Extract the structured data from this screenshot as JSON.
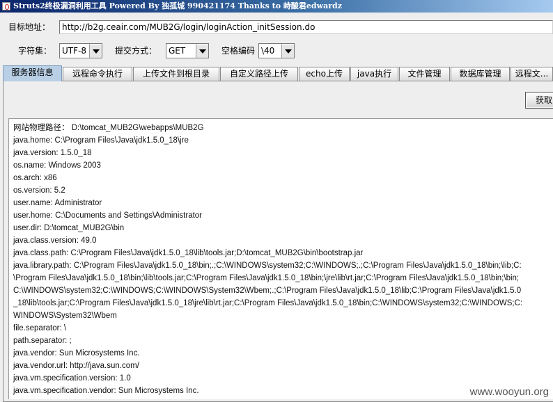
{
  "window": {
    "title": "Struts2终极漏洞利用工具    Powered By 独孤城 990421174 Thanks to 峙酸君edwardz"
  },
  "form": {
    "target_label": "目标地址：",
    "target_url": "http://b2g.ceair.com/MUB2G/login/loginAction_initSession.do",
    "charset_label": "字符集：",
    "charset_value": "UTF-8",
    "method_label": "提交方式：",
    "method_value": "GET",
    "space_encoding_label": "空格编码",
    "space_encoding_value": "\\40"
  },
  "tabs": [
    {
      "label": "服务器信息",
      "active": true
    },
    {
      "label": "远程命令执行"
    },
    {
      "label": "上传文件到根目录"
    },
    {
      "label": "自定义路径上传"
    },
    {
      "label": "echo上传"
    },
    {
      "label": "java执行"
    },
    {
      "label": "文件管理"
    },
    {
      "label": "数据库管理"
    },
    {
      "label": "远程文..."
    }
  ],
  "panel": {
    "fetch_button": "获取"
  },
  "output_lines": [
    "网站物理路径： D:\\tomcat_MUB2G\\webapps\\MUB2G",
    "java.home: C:\\Program Files\\Java\\jdk1.5.0_18\\jre",
    "java.version: 1.5.0_18",
    "os.name: Windows 2003",
    "os.arch: x86",
    "os.version: 5.2",
    "user.name: Administrator",
    "user.home: C:\\Documents and Settings\\Administrator",
    "user.dir: D:\\tomcat_MUB2G\\bin",
    "java.class.version: 49.0",
    "java.class.path: C:\\Program Files\\Java\\jdk1.5.0_18\\lib\\tools.jar;D:\\tomcat_MUB2G\\bin\\bootstrap.jar",
    "java.library.path: C:\\Program Files\\Java\\jdk1.5.0_18\\bin;.;C:\\WINDOWS\\system32;C:\\WINDOWS;.;C:\\Program Files\\Java\\jdk1.5.0_18\\bin;\\lib;C:",
    "\\Program Files\\Java\\jdk1.5.0_18\\bin;\\lib\\tools.jar;C:\\Program Files\\Java\\jdk1.5.0_18\\bin;\\jre\\lib\\rt.jar;C:\\Program Files\\Java\\jdk1.5.0_18\\bin;\\bin;",
    "C:\\WINDOWS\\system32;C:\\WINDOWS;C:\\WINDOWS\\System32\\Wbem;.;C:\\Program Files\\Java\\jdk1.5.0_18\\lib;C:\\Program Files\\Java\\jdk1.5.0",
    "_18\\lib\\tools.jar;C:\\Program Files\\Java\\jdk1.5.0_18\\jre\\lib\\rt.jar;C:\\Program Files\\Java\\jdk1.5.0_18\\bin;C:\\WINDOWS\\system32;C:\\WINDOWS;C:",
    "WINDOWS\\System32\\Wbem",
    "file.separator: \\",
    "path.separator: ;",
    "java.vendor: Sun Microsystems Inc.",
    "java.vendor.url: http://java.sun.com/",
    "java.vm.specification.version: 1.0",
    "java.vm.specification.vendor: Sun Microsystems Inc."
  ],
  "watermark": "www.wooyun.org"
}
